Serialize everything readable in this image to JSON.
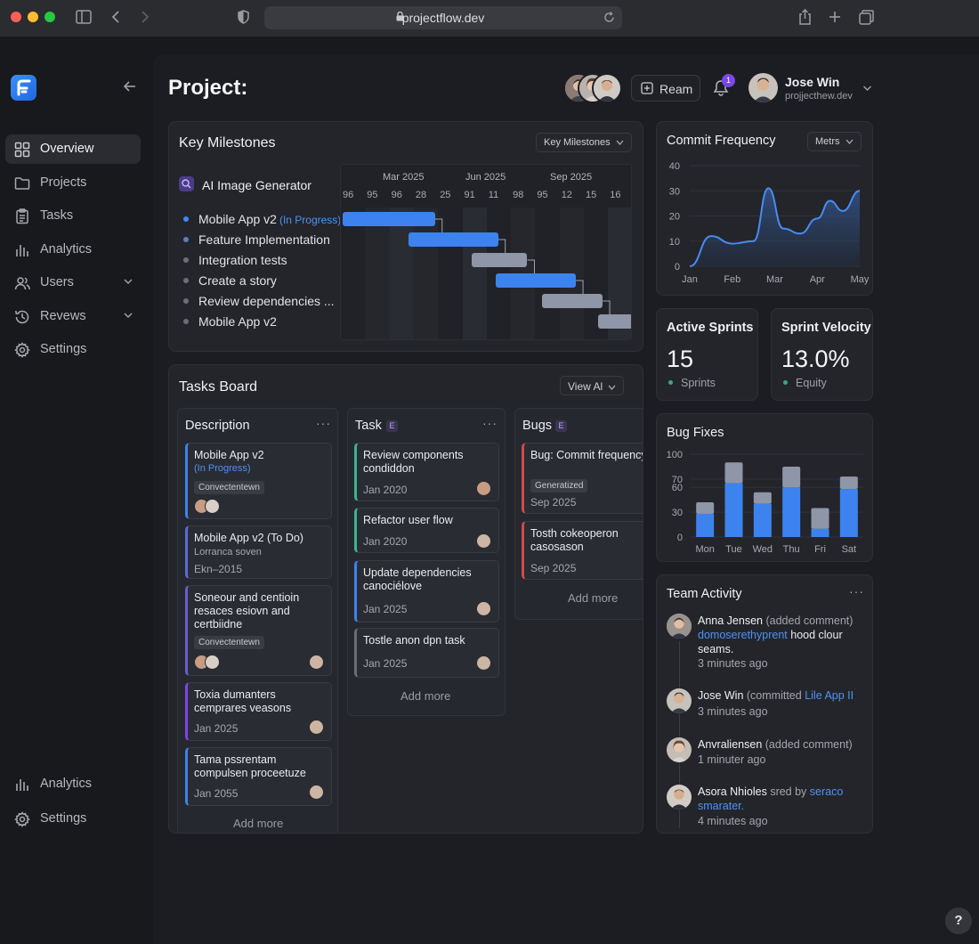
{
  "browser": {
    "url": "projectflow.dev"
  },
  "sidebar": {
    "items": [
      {
        "label": "Overview",
        "icon": "grid-icon"
      },
      {
        "label": "Projects",
        "icon": "folder-icon"
      },
      {
        "label": "Tasks",
        "icon": "clipboard-icon"
      },
      {
        "label": "Analytics",
        "icon": "bar-chart-icon"
      },
      {
        "label": "Users",
        "icon": "users-icon"
      },
      {
        "label": "Revews",
        "icon": "history-icon"
      },
      {
        "label": "Settings",
        "icon": "gear-icon"
      }
    ],
    "bottom": [
      {
        "label": "Analytics",
        "icon": "bar-chart-icon"
      },
      {
        "label": "Settings",
        "icon": "gear-icon"
      }
    ]
  },
  "header": {
    "title": "Project:",
    "ream_label": "Ream",
    "notifications": "1",
    "user_name": "Jose Win",
    "user_sub": "projjecthew.dev"
  },
  "milestones": {
    "title": "Key Milestones",
    "dropdown": "Key Milestones",
    "project": "AI Image Generator",
    "rows": [
      {
        "label": "Mobile App v2",
        "status": "(In Progress)"
      },
      {
        "label": "Feature Implementation",
        "status": ""
      },
      {
        "label": "Integration tests",
        "status": ""
      },
      {
        "label": "Create a story",
        "status": ""
      },
      {
        "label": "Review dependencies ...",
        "status": ""
      },
      {
        "label": "Mobile App v2",
        "status": ""
      }
    ],
    "months": [
      "Mar 2025",
      "Jun 2025",
      "Sep 2025"
    ],
    "days": [
      "96",
      "95",
      "96",
      "28",
      "25",
      "91",
      "11",
      "98",
      "95",
      "12",
      "15",
      "16"
    ],
    "bars": [
      {
        "start": 0.0,
        "span": 3.8,
        "color": "#3d83ef"
      },
      {
        "start": 2.7,
        "span": 3.7,
        "color": "#3d83ef"
      },
      {
        "start": 5.3,
        "span": 2.3,
        "color": "#8e96a8"
      },
      {
        "start": 6.3,
        "span": 3.3,
        "color": "#3d83ef"
      },
      {
        "start": 8.2,
        "span": 2.5,
        "color": "#8e96a8"
      },
      {
        "start": 10.5,
        "span": 1.5,
        "color": "#8e96a8"
      }
    ]
  },
  "board": {
    "title": "Tasks Board",
    "dropdown": "View Al",
    "add_more": "Add more",
    "columns": [
      {
        "title": "Description",
        "cards": [
          {
            "title": "Mobile App v2",
            "status": "(In Progress)",
            "chip": "Convectentewn"
          },
          {
            "title": "Mobile App v2 (To Do)",
            "sub": "Lorranca soven",
            "date": "Ekn–2015"
          },
          {
            "title": "Soneour and centioin resaces esiovn and certbiidne",
            "chip": "Convectentewn"
          },
          {
            "title": "Toxia dumanters cemprares veasons",
            "date": "Jan 2025"
          },
          {
            "title": "Tama pssrentam compulsen proceetuze",
            "date": "Jan 2055"
          }
        ]
      },
      {
        "title": "Task",
        "badge": "E",
        "cards": [
          {
            "title": "Review components condiddon",
            "date": "Jan 2020"
          },
          {
            "title": "Refactor user flow",
            "date": "Jan 2020"
          },
          {
            "title": "Update dependencies canociélove",
            "date": "Jan 2025"
          },
          {
            "title": "Tostle anon dpn task",
            "date": "Jan 2025"
          }
        ]
      },
      {
        "title": "Bugs",
        "badge": "E",
        "cards": [
          {
            "title": "Bug: Commit frequency salim satemibilers",
            "chip": "Generatized",
            "date": "Sep 2025"
          },
          {
            "title": "Tosth cokeoperon casosason",
            "date": "Sep 2025"
          }
        ]
      }
    ]
  },
  "commit": {
    "title": "Commit Frequency",
    "dropdown": "Metrs"
  },
  "sprints": {
    "title": "Active Sprints",
    "value": "15",
    "sub": "Sprints"
  },
  "velocity": {
    "title": "Sprint Velocity",
    "value": "13.0%",
    "sub": "Equity"
  },
  "bugs": {
    "title": "Bug Fixes"
  },
  "activity": {
    "title": "Team Activity",
    "items": [
      {
        "name": "Anna Jensen",
        "action": "(added comment)",
        "link": "domoserethyprent",
        "rest": "hood clour seams.",
        "time": "3 minutes ago"
      },
      {
        "name": "Jose Win",
        "action": "(committed",
        "link": "Lile App II",
        "rest": "",
        "time": "3 minutes ago"
      },
      {
        "name": "Anvraliensen",
        "action": "(added comment)",
        "link": "",
        "rest": "",
        "time": "1 minuter ago"
      },
      {
        "name": "Asora Nhioles",
        "action": "sred by",
        "link": "seraco smarater.",
        "rest": "",
        "time": "4 minutes ago"
      }
    ]
  },
  "colors": {
    "accent": "#3d83ef",
    "muted_bar": "#8e96a8",
    "purple": "#7b46e8"
  },
  "chart_data": [
    {
      "type": "area",
      "x": [
        "Jan",
        "Feb",
        "Mar",
        "Apr",
        "May"
      ],
      "points": [
        [
          0,
          0
        ],
        [
          0.5,
          12
        ],
        [
          1,
          9
        ],
        [
          1.5,
          10
        ],
        [
          1.85,
          31
        ],
        [
          2.2,
          15
        ],
        [
          2.6,
          13
        ],
        [
          3,
          19
        ],
        [
          3.3,
          26
        ],
        [
          3.6,
          22
        ],
        [
          4,
          30
        ]
      ],
      "ylim": [
        0,
        40
      ],
      "yticks": [
        0,
        10,
        20,
        30,
        40
      ],
      "grid": true
    },
    {
      "type": "bar",
      "stacked": true,
      "categories": [
        "Mon",
        "Tue",
        "Wed",
        "Thu",
        "Fri",
        "Sat"
      ],
      "series": [
        {
          "values": [
            28,
            65,
            40,
            60,
            10,
            58
          ]
        },
        {
          "values": [
            14,
            25,
            14,
            25,
            25,
            15
          ]
        }
      ],
      "ylim": [
        0,
        100
      ],
      "yticks": [
        0,
        30,
        60,
        70,
        100
      ],
      "grid": true
    }
  ]
}
